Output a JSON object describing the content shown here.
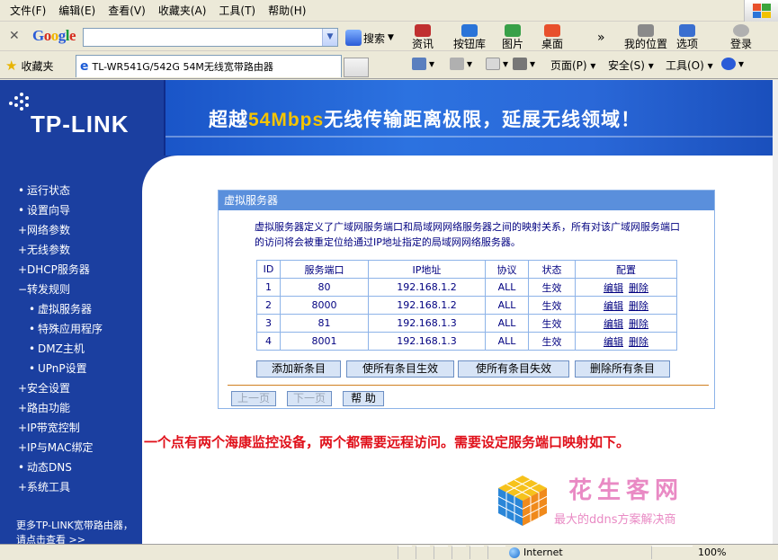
{
  "menu": [
    "文件(F)",
    "编辑(E)",
    "查看(V)",
    "收藏夹(A)",
    "工具(T)",
    "帮助(H)"
  ],
  "google_toolbar": {
    "logo": "Google",
    "search_value": "",
    "search_button": "搜索",
    "buttons": [
      "资讯",
      "按钮库",
      "图片",
      "桌面"
    ],
    "more": "»",
    "right_buttons": [
      "我的位置",
      "选项",
      "登录"
    ]
  },
  "tab_bar": {
    "favorites": "收藏夹",
    "tab_title": "TL-WR541G/542G 54M无线宽带路由器",
    "commands": [
      "页面(P)",
      "安全(S)",
      "工具(O)"
    ]
  },
  "header": {
    "logo": "TP-LINK",
    "slogan_pre": "超越",
    "slogan_hl": "54Mbps",
    "slogan_post": "无线传输距离极限，延展无线领域！"
  },
  "nav": [
    {
      "label": "运行状态",
      "bullet": "•",
      "sub": false
    },
    {
      "label": "设置向导",
      "bullet": "•",
      "sub": false
    },
    {
      "label": "网络参数",
      "bullet": "+",
      "sub": false
    },
    {
      "label": "无线参数",
      "bullet": "+",
      "sub": false
    },
    {
      "label": "DHCP服务器",
      "bullet": "+",
      "sub": false
    },
    {
      "label": "转发规则",
      "bullet": "−",
      "sub": false
    },
    {
      "label": "虚拟服务器",
      "bullet": "•",
      "sub": true
    },
    {
      "label": "特殊应用程序",
      "bullet": "•",
      "sub": true
    },
    {
      "label": "DMZ主机",
      "bullet": "•",
      "sub": true
    },
    {
      "label": "UPnP设置",
      "bullet": "•",
      "sub": true
    },
    {
      "label": "安全设置",
      "bullet": "+",
      "sub": false
    },
    {
      "label": "路由功能",
      "bullet": "+",
      "sub": false
    },
    {
      "label": "IP带宽控制",
      "bullet": "+",
      "sub": false
    },
    {
      "label": "IP与MAC绑定",
      "bullet": "+",
      "sub": false
    },
    {
      "label": "动态DNS",
      "bullet": "•",
      "sub": false
    },
    {
      "label": "系统工具",
      "bullet": "+",
      "sub": false
    }
  ],
  "more_text": "更多TP-LINK宽带路由器，请点击查看 >>",
  "panel": {
    "title": "虚拟服务器",
    "description": "虚拟服务器定义了广域网服务端口和局域网网络服务器之间的映射关系，所有对该广域网服务端口的访问将会被重定位给通过IP地址指定的局域网网络服务器。",
    "columns": [
      "ID",
      "服务端口",
      "IP地址",
      "协议",
      "状态",
      "配置"
    ],
    "rows": [
      {
        "id": "1",
        "port": "80",
        "ip": "192.168.1.2",
        "proto": "ALL",
        "status": "生效",
        "edit": "编辑",
        "del": "删除"
      },
      {
        "id": "2",
        "port": "8000",
        "ip": "192.168.1.2",
        "proto": "ALL",
        "status": "生效",
        "edit": "编辑",
        "del": "删除"
      },
      {
        "id": "3",
        "port": "81",
        "ip": "192.168.1.3",
        "proto": "ALL",
        "status": "生效",
        "edit": "编辑",
        "del": "删除"
      },
      {
        "id": "4",
        "port": "8001",
        "ip": "192.168.1.3",
        "proto": "ALL",
        "status": "生效",
        "edit": "编辑",
        "del": "删除"
      }
    ],
    "actions": [
      "添加新条目",
      "使所有条目生效",
      "使所有条目失效",
      "删除所有条目"
    ],
    "pager": {
      "prev": "上一页",
      "next": "下一页",
      "help": "帮 助"
    }
  },
  "note": "一个点有两个海康监控设备，两个都需要远程访问。需要设定服务端口映射如下。",
  "watermark": {
    "name": "花生客网",
    "tagline": "最大的ddns方案解决商"
  },
  "status": {
    "zone": "Internet",
    "zoom": "100%"
  },
  "colors": {
    "nav_bg": "#1b3fa0",
    "panel_title": "#5a8fdc",
    "note": "#e0101a",
    "watermark": "#e98ac4"
  }
}
